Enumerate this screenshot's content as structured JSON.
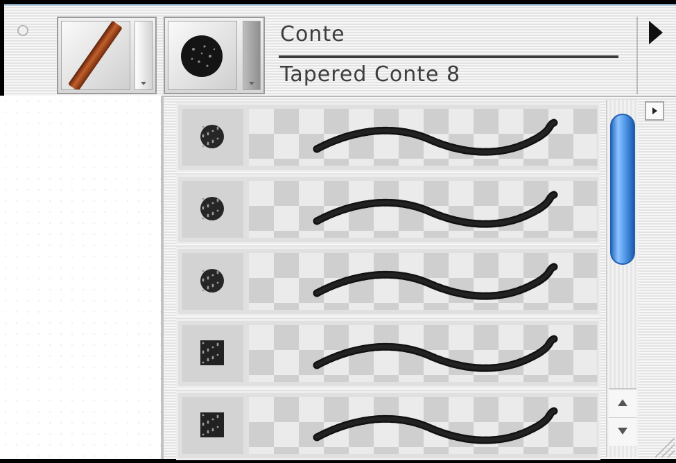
{
  "toolbar": {
    "category_name": "Conte",
    "variant_name": "Tapered Conte 8"
  },
  "icons": {
    "category_icon": "conte-stick-icon",
    "variant_icon": "brush-dab-icon",
    "menu": "triangle-right-icon"
  },
  "variants": [
    {
      "dab": "round-grain"
    },
    {
      "dab": "round-grain"
    },
    {
      "dab": "round-grain"
    },
    {
      "dab": "square-grain"
    },
    {
      "dab": "square-grain"
    }
  ],
  "colors": {
    "accent_scroll_thumb": "#4a90e2",
    "conte_stick": "#a0451e"
  }
}
